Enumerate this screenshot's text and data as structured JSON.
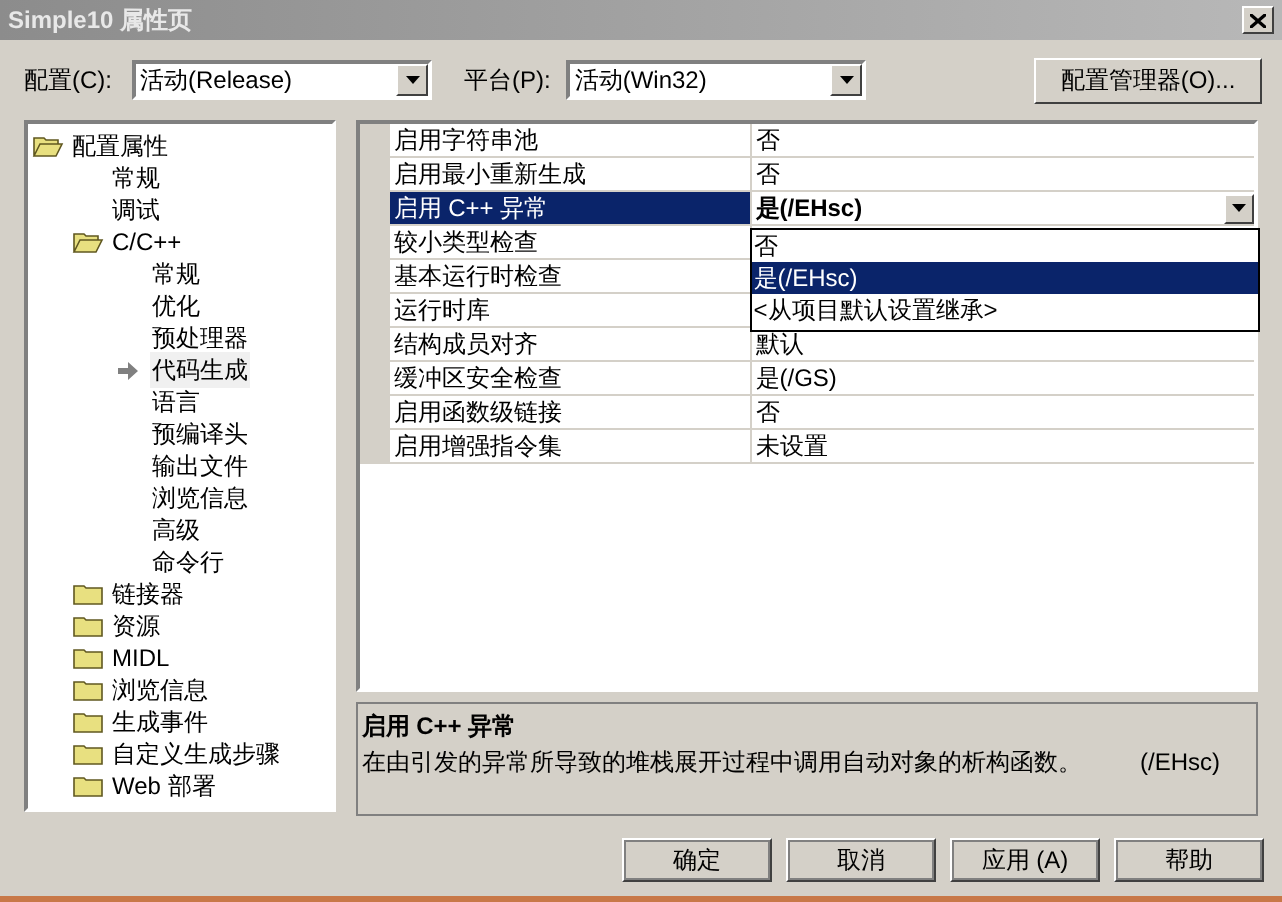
{
  "window": {
    "title": "Simple10 属性页"
  },
  "toolbar": {
    "config_label": "配置(C):",
    "config_value": "活动(Release)",
    "platform_label": "平台(P):",
    "platform_value": "活动(Win32)",
    "manager_button": "配置管理器(O)..."
  },
  "tree": [
    {
      "label": "配置属性",
      "kind": "folder",
      "expanded": true,
      "selected": false,
      "children": [
        {
          "label": "常规",
          "kind": "page",
          "selected": false
        },
        {
          "label": "调试",
          "kind": "page",
          "selected": false
        },
        {
          "label": "C/C++",
          "kind": "folder",
          "expanded": true,
          "selected": false,
          "children": [
            {
              "label": "常规",
              "kind": "page",
              "selected": false
            },
            {
              "label": "优化",
              "kind": "page",
              "selected": false
            },
            {
              "label": "预处理器",
              "kind": "page",
              "selected": false
            },
            {
              "label": "代码生成",
              "kind": "page",
              "selected": true
            },
            {
              "label": "语言",
              "kind": "page",
              "selected": false
            },
            {
              "label": "预编译头",
              "kind": "page",
              "selected": false
            },
            {
              "label": "输出文件",
              "kind": "page",
              "selected": false
            },
            {
              "label": "浏览信息",
              "kind": "page",
              "selected": false
            },
            {
              "label": "高级",
              "kind": "page",
              "selected": false
            },
            {
              "label": "命令行",
              "kind": "page",
              "selected": false
            }
          ]
        },
        {
          "label": "链接器",
          "kind": "folder",
          "expanded": false,
          "selected": false
        },
        {
          "label": "资源",
          "kind": "folder",
          "expanded": false,
          "selected": false
        },
        {
          "label": "MIDL",
          "kind": "folder",
          "expanded": false,
          "selected": false
        },
        {
          "label": "浏览信息",
          "kind": "folder",
          "expanded": false,
          "selected": false
        },
        {
          "label": "生成事件",
          "kind": "folder",
          "expanded": false,
          "selected": false
        },
        {
          "label": "自定义生成步骤",
          "kind": "folder",
          "expanded": false,
          "selected": false
        },
        {
          "label": "Web 部署",
          "kind": "folder",
          "expanded": false,
          "selected": false
        }
      ]
    }
  ],
  "properties": [
    {
      "name": "启用字符串池",
      "value": "否",
      "selected": false
    },
    {
      "name": "启用最小重新生成",
      "value": "否",
      "selected": false
    },
    {
      "name": "启用 C++ 异常",
      "value": "是(/EHsc)",
      "selected": true
    },
    {
      "name": "较小类型检查",
      "selected": false
    },
    {
      "name": "基本运行时检查",
      "selected": false
    },
    {
      "name": "运行时库",
      "selected": false
    },
    {
      "name": "结构成员对齐",
      "value": "默认",
      "selected": false
    },
    {
      "name": "缓冲区安全检查",
      "value": "是(/GS)",
      "selected": false
    },
    {
      "name": "启用函数级链接",
      "value": "否",
      "selected": false
    },
    {
      "name": "启用增强指令集",
      "value": "未设置",
      "selected": false
    }
  ],
  "dropdown": {
    "options": [
      {
        "label": "否",
        "selected": false
      },
      {
        "label": "是(/EHsc)",
        "selected": true
      },
      {
        "label": "<从项目默认设置继承>",
        "selected": false
      }
    ]
  },
  "description": {
    "title": "启用 C++ 异常",
    "text": "在由引发的异常所导致的堆栈展开过程中调用自动对象的析构函数。",
    "flag_text": "(/EHsc)"
  },
  "buttons": [
    "确定",
    "取消",
    "应用 (A)",
    "帮助"
  ]
}
